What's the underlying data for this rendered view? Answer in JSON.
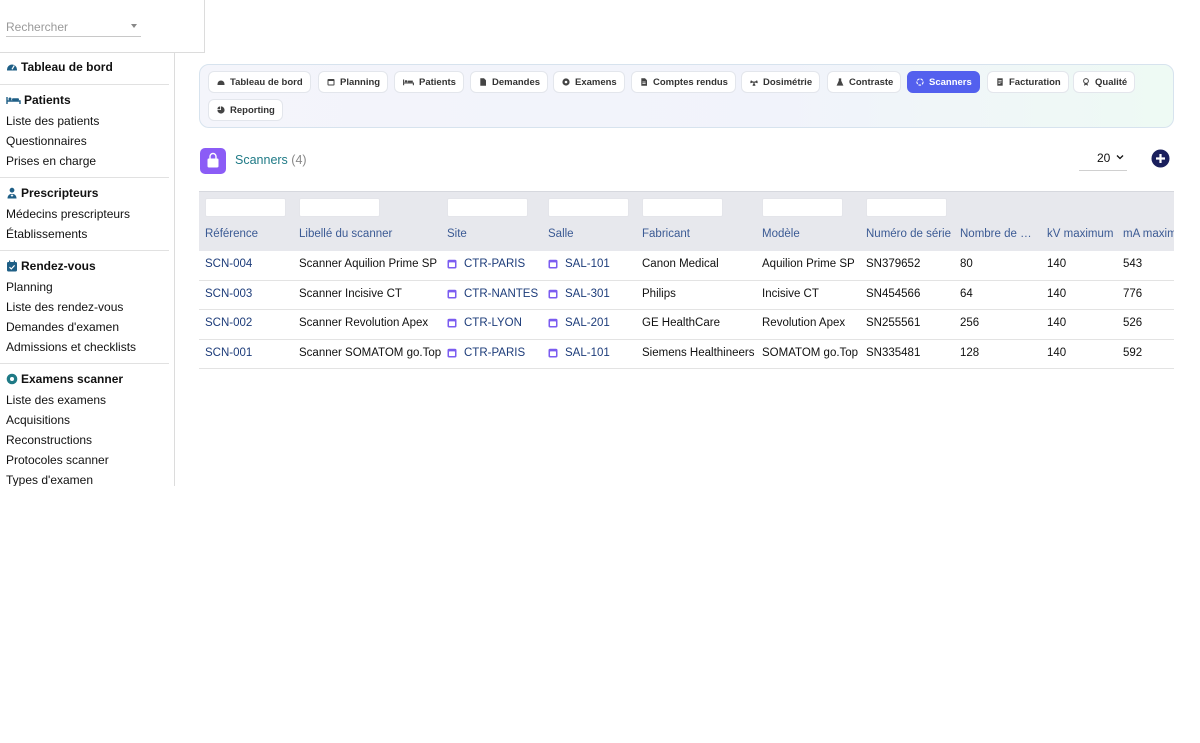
{
  "search": {
    "placeholder": "Rechercher"
  },
  "sidebar": {
    "sections": [
      {
        "title": "Tableau de bord",
        "icon": "gauge-icon",
        "items": []
      },
      {
        "title": "Patients",
        "icon": "bed-icon",
        "items": [
          "Liste des patients",
          "Questionnaires",
          "Prises en charge"
        ]
      },
      {
        "title": "Prescripteurs",
        "icon": "doctor-icon",
        "items": [
          "Médecins prescripteurs",
          "Établissements"
        ]
      },
      {
        "title": "Rendez-vous",
        "icon": "calendar-check-icon",
        "items": [
          "Planning",
          "Liste des rendez-vous",
          "Demandes d'examen",
          "Admissions et checklists"
        ]
      },
      {
        "title": "Examens scanner",
        "icon": "disc-icon",
        "items": [
          "Liste des examens",
          "Acquisitions",
          "Reconstructions",
          "Protocoles scanner",
          "Types d'examen"
        ]
      }
    ]
  },
  "tabs": [
    {
      "label": "Tableau de bord",
      "icon": "gauge-icon",
      "active": false
    },
    {
      "label": "Planning",
      "icon": "calendar-icon",
      "active": false
    },
    {
      "label": "Patients",
      "icon": "bed-icon",
      "active": false
    },
    {
      "label": "Demandes",
      "icon": "document-icon",
      "active": false
    },
    {
      "label": "Examens",
      "icon": "disc-icon",
      "active": false
    },
    {
      "label": "Comptes rendus",
      "icon": "report-icon",
      "active": false
    },
    {
      "label": "Dosimétrie",
      "icon": "radiation-icon",
      "active": false
    },
    {
      "label": "Contraste",
      "icon": "flask-icon",
      "active": false
    },
    {
      "label": "Scanners",
      "icon": "ring-icon",
      "active": true
    },
    {
      "label": "Facturation",
      "icon": "invoice-icon",
      "active": false
    },
    {
      "label": "Qualité",
      "icon": "award-icon",
      "active": false
    },
    {
      "label": "Reporting",
      "icon": "pie-chart-icon",
      "active": false
    }
  ],
  "header": {
    "title": "Scanners",
    "count": "(4)",
    "page_size": "20"
  },
  "colors": {
    "accent": "#5360ee",
    "title": "#1f7a86",
    "link": "#1d3c7a",
    "module": "#8b5cf6",
    "add": "#1a1f5c"
  },
  "table": {
    "columns": [
      "Référence",
      "Libellé du scanner",
      "Site",
      "Salle",
      "Fabricant",
      "Modèle",
      "Numéro de série",
      "Nombre de barrettes",
      "kV maximum",
      "mA maximum"
    ],
    "rows": [
      [
        "SCN-004",
        "Scanner Aquilion Prime SP",
        "CTR-PARIS",
        "SAL-101",
        "Canon Medical",
        "Aquilion Prime SP",
        "SN379652",
        "80",
        "140",
        "543"
      ],
      [
        "SCN-003",
        "Scanner Incisive CT",
        "CTR-NANTES",
        "SAL-301",
        "Philips",
        "Incisive CT",
        "SN454566",
        "64",
        "140",
        "776"
      ],
      [
        "SCN-002",
        "Scanner Revolution Apex",
        "CTR-LYON",
        "SAL-201",
        "GE HealthCare",
        "Revolution Apex",
        "SN255561",
        "256",
        "140",
        "526"
      ],
      [
        "SCN-001",
        "Scanner SOMATOM go.Top",
        "CTR-PARIS",
        "SAL-101",
        "Siemens Healthineers",
        "SOMATOM go.Top",
        "SN335481",
        "128",
        "140",
        "592"
      ]
    ]
  }
}
